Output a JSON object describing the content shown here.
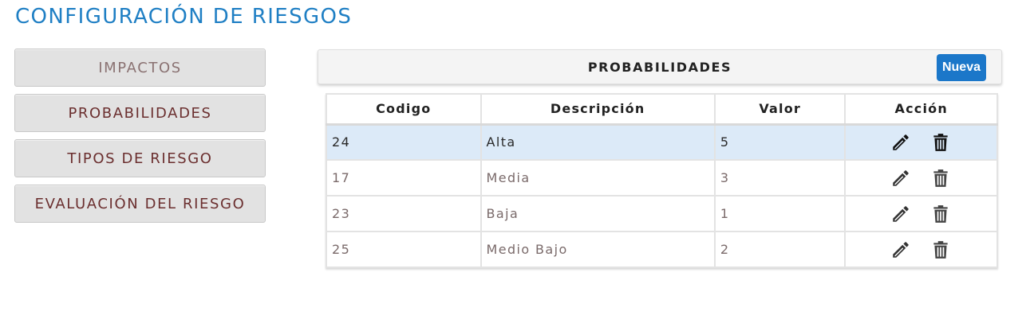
{
  "page": {
    "title": "CONFIGURACIÓN DE RIESGOS"
  },
  "sidebar": {
    "items": [
      {
        "label": "IMPACTOS",
        "active": true
      },
      {
        "label": "PROBABILIDADES",
        "active": false
      },
      {
        "label": "TIPOS DE RIESGO",
        "active": false
      },
      {
        "label": "EVALUACIÓN DEL RIESGO",
        "active": false
      }
    ]
  },
  "panel": {
    "title": "PROBABILIDADES",
    "new_button_label": "Nueva"
  },
  "table": {
    "columns": [
      "Codigo",
      "Descripción",
      "Valor",
      "Acción"
    ],
    "rows": [
      {
        "codigo": "24",
        "descripcion": "Alta",
        "valor": "5",
        "selected": true
      },
      {
        "codigo": "17",
        "descripcion": "Media",
        "valor": "3",
        "selected": false
      },
      {
        "codigo": "23",
        "descripcion": "Baja",
        "valor": "1",
        "selected": false
      },
      {
        "codigo": "25",
        "descripcion": "Medio Bajo",
        "valor": "2",
        "selected": false
      }
    ],
    "row_actions": [
      "pencil-icon",
      "trash-icon"
    ]
  },
  "colors": {
    "title_blue": "#1f7fc4",
    "button_blue": "#1b77c9",
    "menu_text": "#6b2f2f",
    "selected_row": "#dceaf8"
  }
}
